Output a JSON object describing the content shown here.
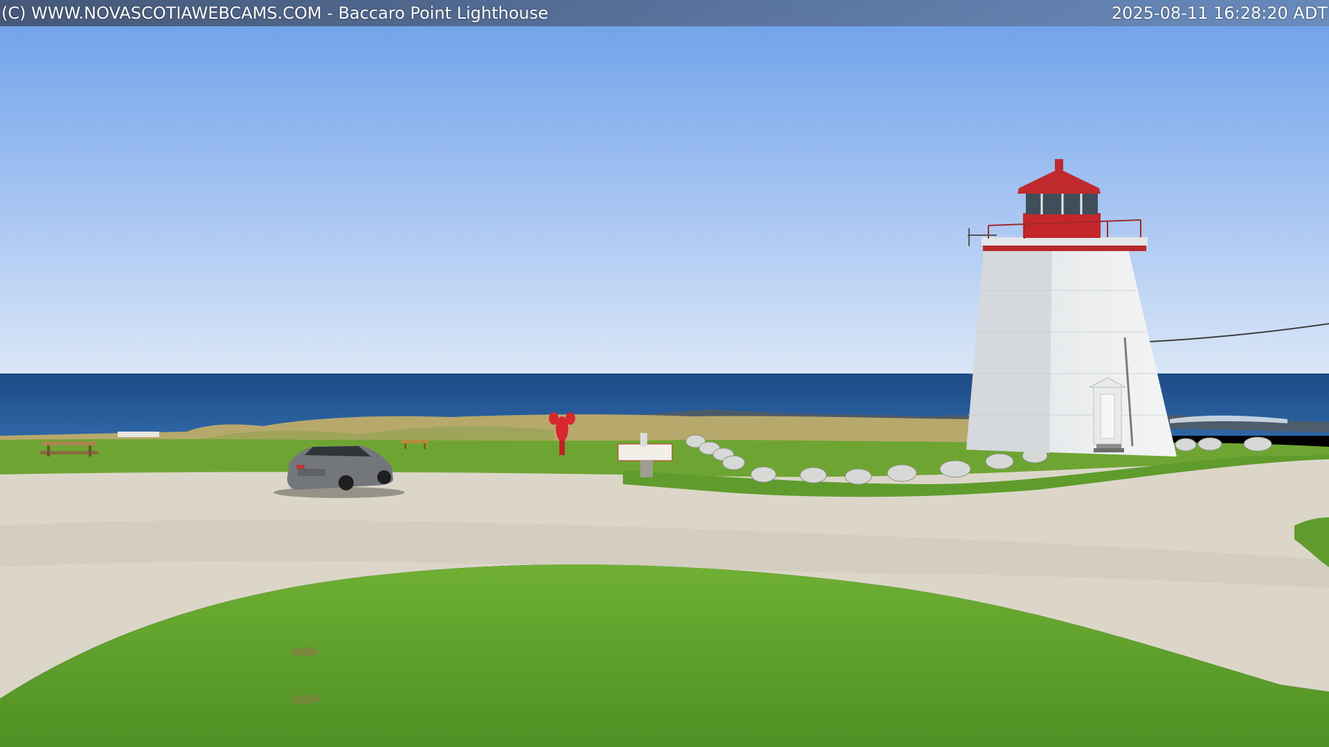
{
  "overlay": {
    "title": "(C) WWW.NOVASCOTIAWEBCAMS.COM - Baccaro Point Lighthouse",
    "timestamp": "2025-08-11 16:28:20 ADT"
  },
  "colors": {
    "sky_top": "#6fa2ea",
    "sky_horizon": "#d9e6f6",
    "ocean": "#1f4f8c",
    "grass": "#63a12e",
    "gravel": "#ddd8cc",
    "lighthouse_white": "#f1f2f2",
    "lighthouse_red": "#c4262c"
  }
}
